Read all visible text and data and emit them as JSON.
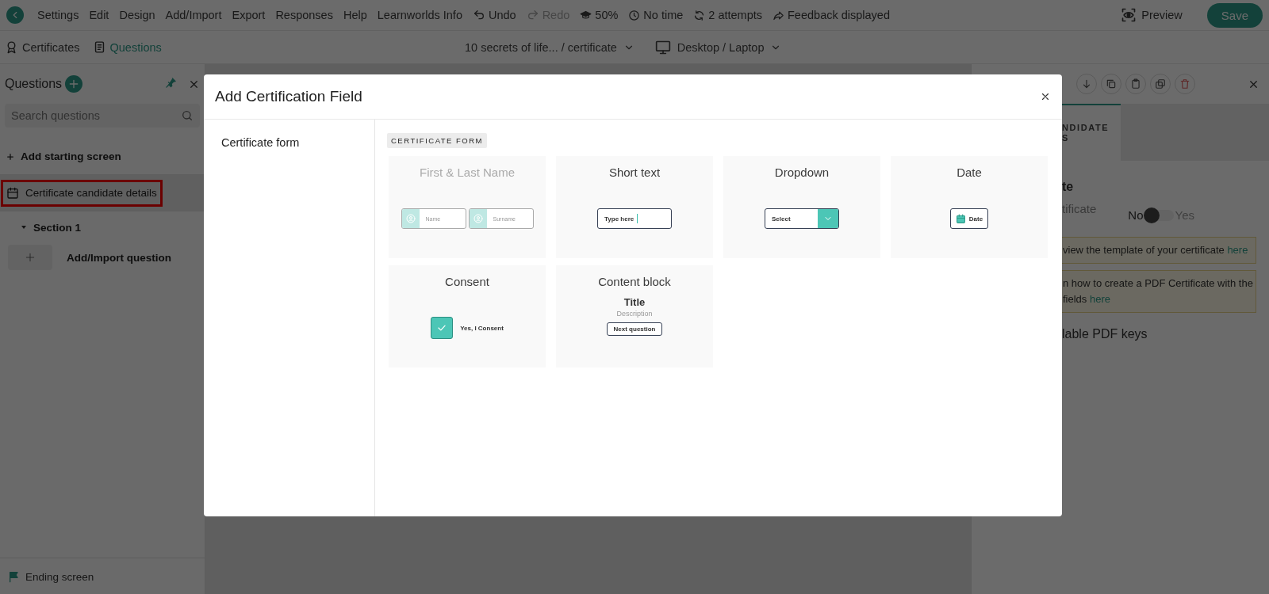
{
  "top_bar": {
    "menu": [
      "Settings",
      "Edit",
      "Design",
      "Add/Import",
      "Export",
      "Responses",
      "Help",
      "Learnworlds Info"
    ],
    "history": [
      {
        "kind": "undo",
        "label": "Undo",
        "disabled": false
      },
      {
        "kind": "redo",
        "label": "Redo",
        "disabled": true
      }
    ],
    "stats": [
      {
        "kind": "score",
        "label": "50%"
      },
      {
        "kind": "time",
        "label": "No time"
      },
      {
        "kind": "attempts",
        "label": "2 attempts"
      },
      {
        "kind": "feedback",
        "label": "Feedback displayed"
      }
    ],
    "preview": "Preview",
    "save": "Save"
  },
  "view_bar": {
    "tabs": [
      {
        "kind": "certificates",
        "label": "Certificates",
        "selected": false
      },
      {
        "kind": "questions",
        "label": "Questions",
        "selected": true
      }
    ],
    "path": "10 secrets of life... / certificate",
    "device": "Desktop / Laptop"
  },
  "sidebar": {
    "title": "Questions",
    "search": {
      "placeholder": "Search questions"
    },
    "items": [
      {
        "kind": "add",
        "label": "Add starting screen"
      },
      {
        "kind": "question",
        "label": "Certificate candidate details",
        "selected": true,
        "highlighted": true
      },
      {
        "kind": "section",
        "label": "Section 1",
        "selected": false,
        "expanded": true
      },
      {
        "kind": "add_question",
        "label": "Add/Import question"
      }
    ],
    "footer": "Ending screen"
  },
  "right_panel": {
    "tab_lines": [
      "NDIDATE",
      "S"
    ],
    "heading": "te",
    "setting_label": "tificate",
    "toggle": {
      "off_label": "No",
      "on_label": "Yes",
      "on": false
    },
    "notices": [
      {
        "lines": [
          {
            "text": "view the template of your certificate",
            "link": "here"
          }
        ]
      },
      {
        "lines": [
          {
            "text": "n how to create a PDF Certificate with the"
          },
          {
            "text": "fields",
            "link": "here"
          }
        ]
      }
    ],
    "keys_heading": "lable PDF keys"
  },
  "modal": {
    "title": "Add Certification Field",
    "categories": [
      {
        "label": "Certificate form",
        "selected": true
      }
    ],
    "section_badge": "CERTIFICATE FORM",
    "cards": [
      {
        "kind": "name",
        "title": "First & Last Name",
        "disabled": true,
        "texts": [
          "Name",
          "Surname"
        ]
      },
      {
        "kind": "short_text",
        "title": "Short text",
        "disabled": false,
        "texts": [
          "Type here"
        ]
      },
      {
        "kind": "dropdown",
        "title": "Dropdown",
        "disabled": false,
        "texts": [
          "Select"
        ]
      },
      {
        "kind": "date",
        "title": "Date",
        "disabled": false,
        "texts": [
          "Date"
        ]
      },
      {
        "kind": "consent",
        "title": "Consent",
        "disabled": false,
        "texts": [
          "Yes, I Consent"
        ]
      },
      {
        "kind": "content_block",
        "title": "Content block",
        "disabled": false,
        "texts": [
          "Title",
          "Description",
          "Next question"
        ]
      }
    ]
  }
}
